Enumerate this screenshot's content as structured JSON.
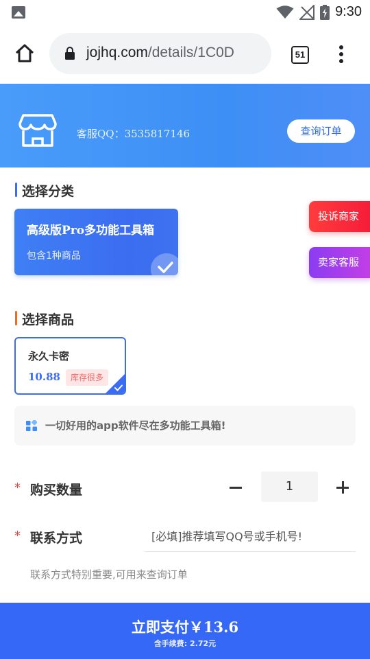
{
  "status_bar": {
    "time": "9:30",
    "icons": [
      "gallery-icon",
      "wifi-icon",
      "no-signal-icon",
      "battery-charging-icon"
    ]
  },
  "browser": {
    "url_host": "jojhq.com",
    "url_path": "/details/1C0D",
    "tab_count": "51",
    "icons": [
      "home-icon",
      "lock-icon",
      "tabs-icon",
      "overflow-menu-icon"
    ]
  },
  "header": {
    "service_qq": "客服QQ：3535817146",
    "query_order_label": "查询订单",
    "icon": "store-icon"
  },
  "category_section": {
    "title": "选择分类",
    "categories": [
      {
        "name": "高级版Pro多功能工具箱",
        "count_text": "包含1种商品",
        "selected": true
      }
    ]
  },
  "floating": {
    "complain_label": "投诉商家",
    "seller_service_label": "卖家客服"
  },
  "product_section": {
    "title": "选择商品",
    "products": [
      {
        "name": "永久卡密",
        "price": "10.88",
        "stock_label": "库存很多",
        "selected": true
      }
    ]
  },
  "notice": {
    "text": "一切好用的app软件尽在多功能工具箱!",
    "icon": "grid-icon"
  },
  "form": {
    "required_mark": "*",
    "quantity_label": "购买数量",
    "quantity_value": "1",
    "contact_label": "联系方式",
    "contact_placeholder": "[必填]推荐填写QQ号或手机号!",
    "contact_value": "",
    "contact_hint": "联系方式特别重要,可用来查询订单"
  },
  "pay": {
    "label": "立即支付",
    "amount": "￥13.6",
    "fee_text": "含手续费: 2.72元"
  },
  "colors": {
    "accent": "#3568f6",
    "complain": "#f51c3a",
    "seller": "#a13cf0",
    "stock_badge": "#fde6e6"
  }
}
